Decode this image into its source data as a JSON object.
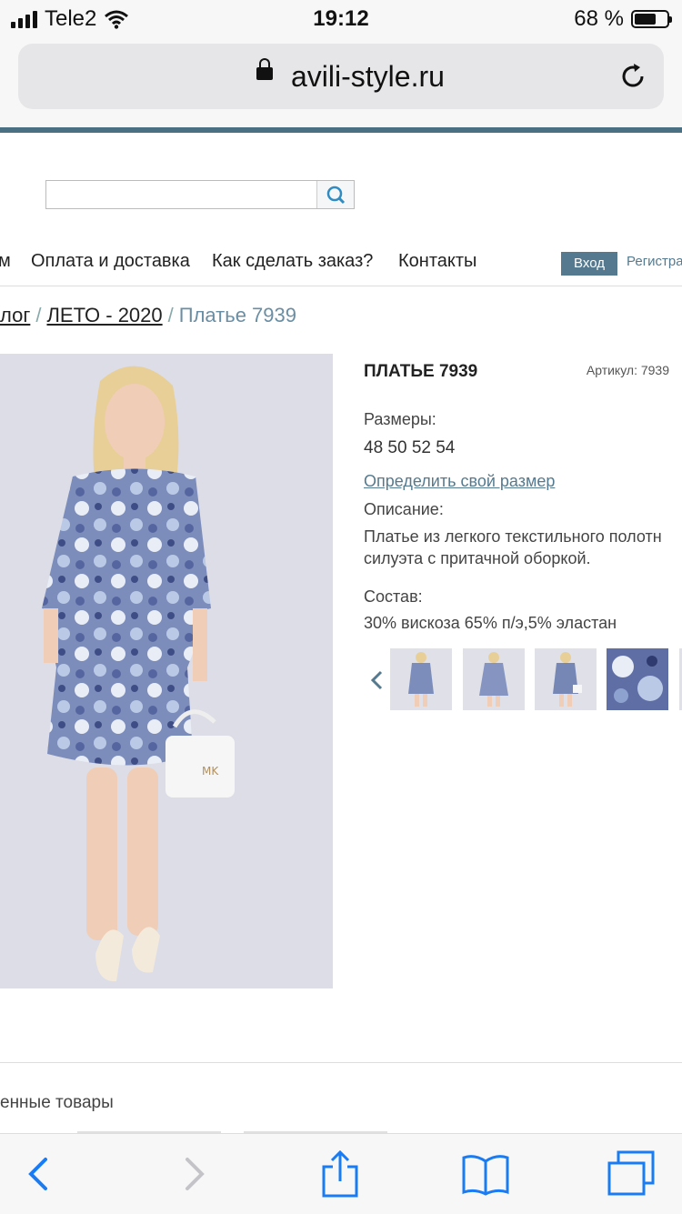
{
  "status": {
    "carrier": "Tele2",
    "time": "19:12",
    "battery": "68 %"
  },
  "browser": {
    "url": "avili-style.ru"
  },
  "search": {
    "placeholder": ""
  },
  "nav": {
    "items": [
      "м",
      "Оплата и доставка",
      "Как сделать заказ?",
      "Контакты"
    ],
    "login": "Вход",
    "register": "Регистра"
  },
  "breadcrumb": {
    "items": [
      "лог",
      "ЛЕТО - 2020"
    ],
    "current": "Платье 7939",
    "separator": "/"
  },
  "product": {
    "title": "ПЛАТЬЕ 7939",
    "article": "Артикул: 7939",
    "sizes_label": "Размеры:",
    "sizes": "48 50 52 54",
    "size_link": "Определить свой размер",
    "description_label": "Описание:",
    "description_line1": "Платье из легкого текстильного полотн",
    "description_line2": "силуэта с притачной оборкой.",
    "composition_label": "Состав:",
    "composition": "30% вискоза 65% п/э,5% эластан"
  },
  "thumbnails": {
    "prev_icon": "chevron-left-icon",
    "count": 4
  },
  "related": {
    "title": "енные товары"
  },
  "colors": {
    "accent": "#557a8f",
    "line": "#4a7084",
    "ios_blue": "#1a7cf5"
  }
}
